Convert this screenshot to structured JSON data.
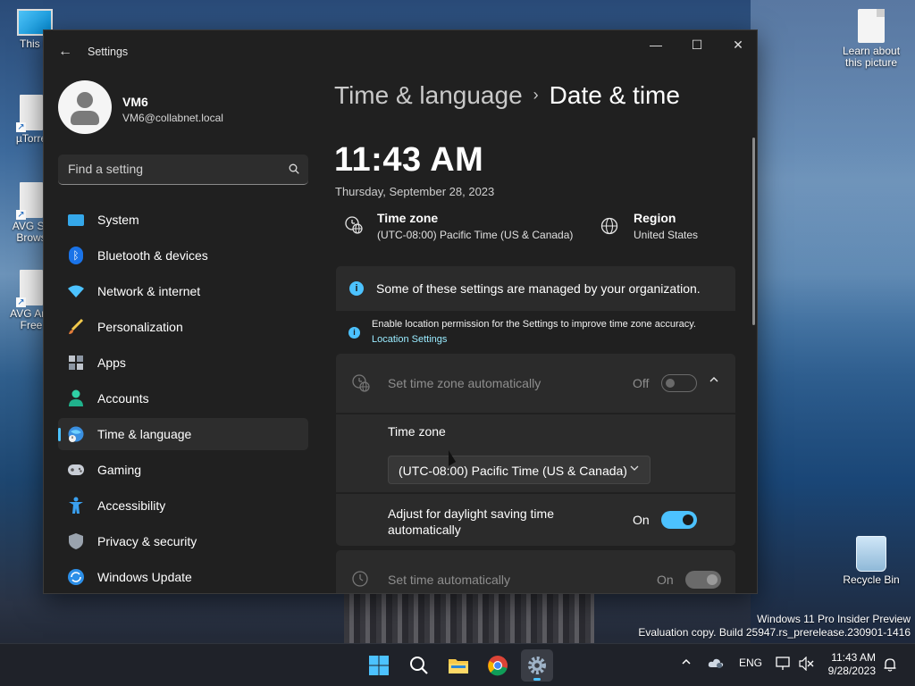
{
  "desktop": {
    "icons": {
      "this_pc": "This P",
      "utorrent": "µTorre",
      "avg_browser": "AVG Se Brows",
      "avg_antivirus": "AVG Anti Free",
      "learn_picture": "Learn about this picture",
      "recycle_bin": "Recycle Bin"
    },
    "watermark": {
      "line1": "Windows 11 Pro Insider Preview",
      "line2": "Evaluation copy. Build 25947.rs_prerelease.230901-1416"
    }
  },
  "window": {
    "title": "Settings",
    "controls": {
      "minimize": "—",
      "maximize": "☐",
      "close": "✕"
    }
  },
  "profile": {
    "name": "VM6",
    "email": "VM6@collabnet.local"
  },
  "search": {
    "placeholder": "Find a setting"
  },
  "sidebar": {
    "items": [
      {
        "label": "System"
      },
      {
        "label": "Bluetooth & devices"
      },
      {
        "label": "Network & internet"
      },
      {
        "label": "Personalization"
      },
      {
        "label": "Apps"
      },
      {
        "label": "Accounts"
      },
      {
        "label": "Time & language"
      },
      {
        "label": "Gaming"
      },
      {
        "label": "Accessibility"
      },
      {
        "label": "Privacy & security"
      },
      {
        "label": "Windows Update"
      }
    ],
    "active_index": 6
  },
  "breadcrumb": {
    "parent": "Time & language",
    "separator": "›",
    "current": "Date & time"
  },
  "clock": {
    "time": "11:43 AM",
    "date": "Thursday, September 28, 2023"
  },
  "summary": {
    "time_zone": {
      "title": "Time zone",
      "value": "(UTC-08:00) Pacific Time (US & Canada)"
    },
    "region": {
      "title": "Region",
      "value": "United States"
    }
  },
  "notices": {
    "managed": "Some of these settings are managed by your organization.",
    "location": "Enable location permission for the Settings to improve time zone accuracy.",
    "location_link": "Location Settings"
  },
  "settings": {
    "tz_auto": {
      "label": "Set time zone automatically",
      "state": "Off"
    },
    "tz_select": {
      "label": "Time zone",
      "value": "(UTC-08:00) Pacific Time (US & Canada)"
    },
    "dst": {
      "label": "Adjust for daylight saving time automatically",
      "state": "On"
    },
    "time_auto": {
      "label": "Set time automatically",
      "state": "On"
    }
  },
  "taskbar": {
    "language": "ENG",
    "time": "11:43 AM",
    "date": "9/28/2023"
  },
  "colors": {
    "accent": "#4cc2ff",
    "window_bg": "#202020",
    "card_bg": "#2b2b2b"
  }
}
